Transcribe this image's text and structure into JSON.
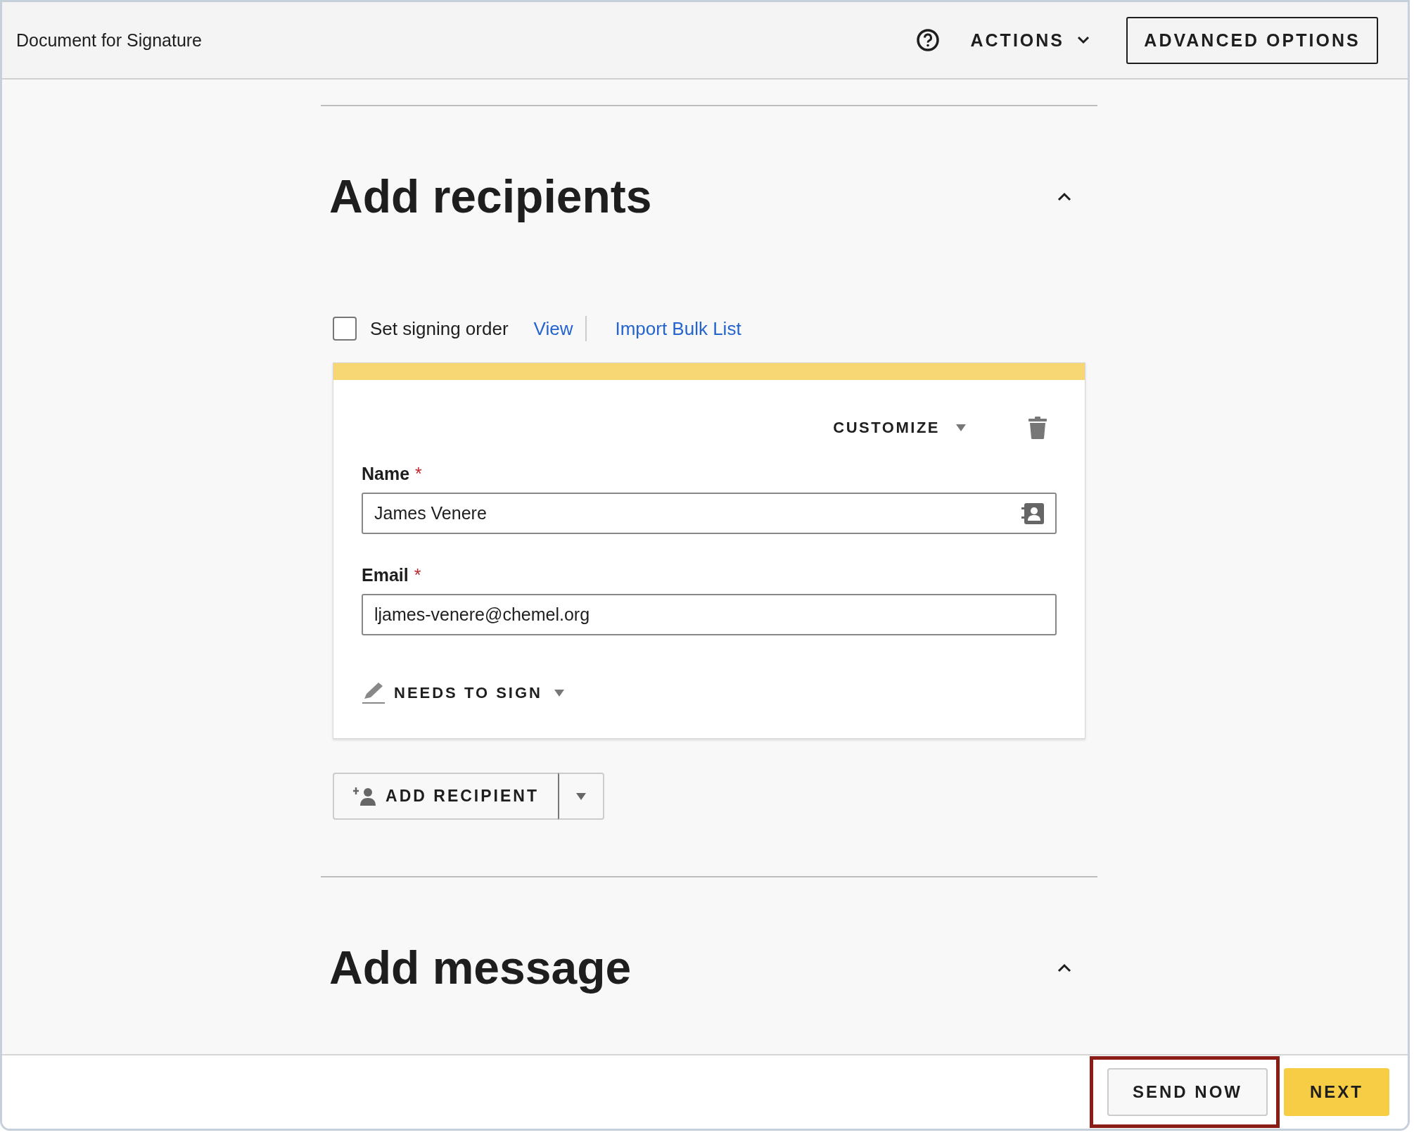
{
  "header": {
    "title": "Document for Signature",
    "actions_menu": "ACTIONS",
    "advanced_button": "ADVANCED OPTIONS"
  },
  "sections": [
    {
      "heading": "Add recipients",
      "expanded": true
    },
    {
      "heading": "Add message",
      "expanded": true
    }
  ],
  "signing_order": {
    "label": "Set signing order",
    "checked": false,
    "links": [
      "View",
      "Import Bulk List"
    ]
  },
  "recipient": {
    "customize": "CUSTOMIZE",
    "fields": [
      {
        "label": "Name",
        "required_mark": "*",
        "value": "James Venere",
        "kind": "contact"
      },
      {
        "label": "Email",
        "required_mark": "*",
        "value": "ljames-venere@chemel.org",
        "kind": "plain"
      }
    ],
    "role": "NEEDS TO SIGN"
  },
  "add_recipient_button": "ADD RECIPIENT",
  "footer": {
    "buttons": [
      {
        "label": "SEND NOW",
        "kind": "secondary",
        "highlighted": true
      },
      {
        "label": "NEXT",
        "kind": "primary",
        "highlighted": false
      }
    ]
  }
}
